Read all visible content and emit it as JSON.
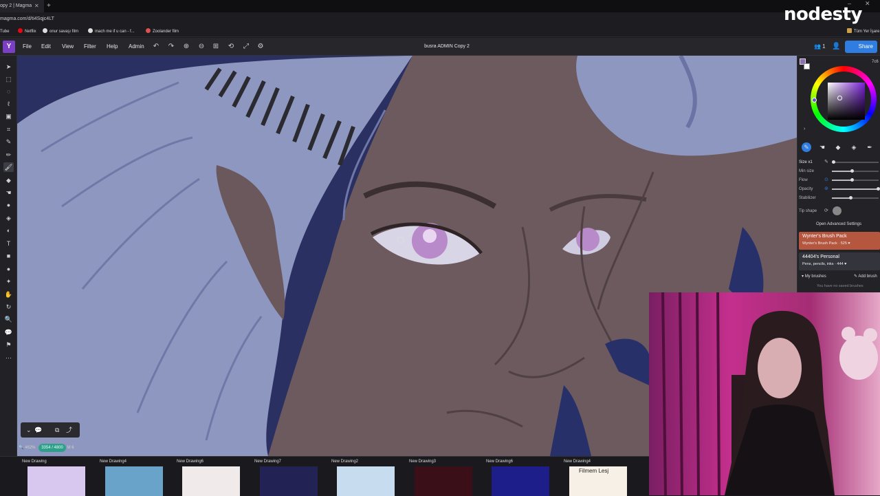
{
  "browser": {
    "tab_title": "opy 2 | Magma",
    "tab_close": "✕",
    "new_tab": "+",
    "url": "magma.com/d/ti4Sqjc4LT",
    "window_min": "–",
    "window_close": "✕",
    "bookmarks": [
      {
        "label": "Tube"
      },
      {
        "label": "Netflix"
      },
      {
        "label": "onur savaşı film"
      },
      {
        "label": "mach me if u can - f..."
      },
      {
        "label": "Zoolander film"
      }
    ],
    "all_bookmarks": "Tüm Yer İşare",
    "colors": {
      "netflix": "#e50914",
      "google": "#4285f4"
    }
  },
  "watermark": "nodesty",
  "menubar": {
    "app_logo": "Y",
    "menus": [
      "File",
      "Edit",
      "View",
      "Filter",
      "Help",
      "Admin"
    ],
    "toolbar_icons": [
      {
        "name": "undo-icon",
        "glyph": "↶"
      },
      {
        "name": "redo-icon",
        "glyph": "↷"
      },
      {
        "name": "zoom-in-icon",
        "glyph": "⊕"
      },
      {
        "name": "zoom-out-icon",
        "glyph": "⊖"
      },
      {
        "name": "fit-icon",
        "glyph": "⊞"
      },
      {
        "name": "rotate-icon",
        "glyph": "⟲"
      },
      {
        "name": "fullscreen-icon",
        "glyph": "⤢"
      },
      {
        "name": "settings-icon",
        "glyph": "⚙"
      }
    ],
    "document_title": "busra ADMIN Copy 2",
    "users_count": "👥 1",
    "add_user_glyph": "👤",
    "share_label": "Share",
    "accent": "#2f7de1"
  },
  "tools": [
    {
      "name": "move-tool-icon",
      "glyph": "➤"
    },
    {
      "name": "rect-select-tool-icon",
      "glyph": "⬚"
    },
    {
      "name": "ellipse-select-tool-icon",
      "glyph": "◌"
    },
    {
      "name": "lasso-tool-icon",
      "glyph": "ℓ"
    },
    {
      "name": "transform-tool-icon",
      "glyph": "▣"
    },
    {
      "name": "crop-tool-icon",
      "glyph": "⌗"
    },
    {
      "name": "eyedropper-tool-icon",
      "glyph": "✎"
    },
    {
      "name": "pencil-tool-icon",
      "glyph": "✏"
    },
    {
      "name": "brush-tool-icon",
      "glyph": "🖌"
    },
    {
      "name": "eraser-tool-icon",
      "glyph": "◆"
    },
    {
      "name": "smudge-tool-icon",
      "glyph": "☚"
    },
    {
      "name": "blur-tool-icon",
      "glyph": "●"
    },
    {
      "name": "fill-tool-icon",
      "glyph": "◈"
    },
    {
      "name": "gradient-tool-icon",
      "glyph": "◐"
    },
    {
      "name": "text-tool-icon",
      "glyph": "T"
    },
    {
      "name": "shape-tool-icon",
      "glyph": "■"
    },
    {
      "name": "circle-tool-icon",
      "glyph": "●"
    },
    {
      "name": "star-tool-icon",
      "glyph": "✦"
    },
    {
      "name": "hand-tool-icon",
      "glyph": "✋"
    },
    {
      "name": "rotate-view-tool-icon",
      "glyph": "↻"
    },
    {
      "name": "zoom-tool-icon",
      "glyph": "🔍"
    },
    {
      "name": "comment-tool-icon",
      "glyph": "💬"
    },
    {
      "name": "reference-tool-icon",
      "glyph": "⚑"
    },
    {
      "name": "more-tools-icon",
      "glyph": "⋯"
    }
  ],
  "canvas": {
    "zoom_controls": [
      "⌄",
      "💬",
      "⧉",
      "⤴"
    ],
    "zoom_level": "462%",
    "canvas_size": "3354 / 4800",
    "layer_info": "M 6"
  },
  "color_panel": {
    "hex": "7c6",
    "foreground": "#8b6fb0",
    "expand_glyph": "›"
  },
  "brush_tabs": [
    {
      "name": "brush-tab-brush",
      "glyph": "✎"
    },
    {
      "name": "brush-tab-smudge",
      "glyph": "☚"
    },
    {
      "name": "brush-tab-eraser",
      "glyph": "◆"
    },
    {
      "name": "brush-tab-fill",
      "glyph": "◈"
    },
    {
      "name": "brush-tab-pen",
      "glyph": "✒"
    }
  ],
  "brush_settings": {
    "size_label": "Size x1",
    "sliders": [
      {
        "label": "Min size",
        "value": 0.42
      },
      {
        "label": "Flow",
        "value": 0.42
      },
      {
        "label": "Opacity",
        "value": 0.99
      },
      {
        "label": "Stabilizer",
        "value": 0.4
      }
    ],
    "tip_shape": "Tip shape",
    "advanced": "Open Advanced Settings"
  },
  "brush_packs": [
    {
      "title": "Wynter's Brush Pack",
      "subtitle": "Wynter's Brush Pack · 525 ♥",
      "color": "#b5573f"
    },
    {
      "title": "44404's Personal",
      "subtitle": "Pens, pencils, inks · 444 ♥",
      "color": "#34343c"
    }
  ],
  "my_brushes": {
    "label": "My brushes",
    "add": "Add brush",
    "empty": "You have no saved brushes"
  },
  "files": [
    {
      "name": "New Drawing",
      "bg": "#d8c8f0"
    },
    {
      "name": "New Drawing4",
      "bg": "#6aa3c9"
    },
    {
      "name": "New Drawing6",
      "bg": "#f0eaea"
    },
    {
      "name": "New Drawing7",
      "bg": "#222255"
    },
    {
      "name": "New Drawing2",
      "bg": "#c8dcf0"
    },
    {
      "name": "New Drawing3",
      "bg": "#3a0f18"
    },
    {
      "name": "New Drawing6",
      "bg": "#1d1e8a"
    },
    {
      "name": "New Drawing4",
      "bg": "#f6f0e6"
    }
  ],
  "thumbnail_captions": {
    "file_8": "Filmem Lesj"
  }
}
